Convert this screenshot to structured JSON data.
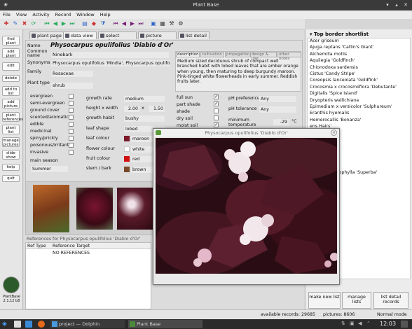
{
  "window": {
    "title": "Plant Base",
    "logo_label": "PlantBase 2.1.12 b8"
  },
  "menu": [
    "File",
    "View",
    "Activity",
    "Record",
    "Window",
    "Help"
  ],
  "tabs": [
    "plant page",
    "data view",
    "select plants",
    "picture maint",
    "list detail"
  ],
  "left_buttons": [
    "find plant",
    "add plant",
    "edit",
    "delete",
    "add to list",
    "add picture",
    "plant references",
    "plant list",
    "manage pictures",
    "slide show",
    "help",
    "quit"
  ],
  "record": {
    "name_label": "Name",
    "name": "Physocarpus opulifolius 'Diablo d'Or'",
    "common_label": "Common name",
    "common": "Ninebark",
    "syn_label": "Synonyms",
    "synonyms": "Physocarpus opulifolius 'Mindia', Physocarpus opulifolius 'Copp",
    "family_label": "Family",
    "family": "Rosaceae",
    "type_label": "Plant type",
    "type": "shrub",
    "desc_tabs": [
      "description",
      "cultivation",
      "propagation",
      "design & use",
      "other notes"
    ],
    "description": "Medium sized deciduous shrub of compact well branched habit with lobed leaves that are amber orange when young, then maturing to deep burgundy maroon. Pink-tinged white flowerheads in early summer. Reddish fruits later.",
    "flags": [
      "evergreen",
      "semi-evergreen",
      "ground cover",
      "scented/aromatic",
      "edible",
      "medicinal",
      "spiny/prickly",
      "poisonous/irritant",
      "invasive"
    ],
    "main_season_label": "main season",
    "main_season": "Summer",
    "growth_rate_label": "growth rate",
    "growth_rate": "medium",
    "hxw_label": "height x width",
    "height": "2.00",
    "x": "x",
    "width": "1.50",
    "habit_label": "growth habit",
    "habit": "bushy",
    "leaf_shape_label": "leaf shape",
    "leaf_shape": "lobed",
    "leaf_colour_label": "leaf colour",
    "leaf_colour": "maroon",
    "flower_colour_label": "flower colour",
    "flower_colour": "white",
    "fruit_colour_label": "fruit colour",
    "fruit_colour": "red",
    "stem_label": "stem / bark",
    "stem": "brown",
    "sun": [
      "full sun",
      "part shade",
      "shade",
      "dry soil",
      "moist soil"
    ],
    "ph_pref_label": "pH preference",
    "ph_pref": "Any",
    "ph_tol_label": "pH tolerance",
    "ph_tol": "Any",
    "min_temp_label": "minimum temperature",
    "min_temp": "-29",
    "temp_unit": "°C"
  },
  "references": {
    "header": "References for Physocarpus opulifolius 'Diablo d'Or'",
    "col1": "Ref Type",
    "col2": "Reference Target",
    "row": "NO REFERENCES"
  },
  "shortlist": {
    "title": "Top border shortlist",
    "items": [
      "Acer griseum",
      "Ajuga reptans 'Catlin's Giant'",
      "Alchemilla mollis",
      "Aquilegia 'Goldfinch'",
      "Chionodoxa sardensis",
      "Cistus 'Candy Stripe'",
      "Coreopsis lanceolata 'Goldfink'",
      "Crocosmia x crocosmiiflora 'Debutante'",
      "Digitalis 'Spice Island'",
      "Dryopteris wallichiana",
      "Epimedium x versicolor 'Sulphureum'",
      "Eranthis hyemalis",
      "Hemerocallis 'Bonanza'",
      "ens Hairs'",
      "den Chimes'",
      "",
      "Nosed'",
      "",
      "",
      "",
      "ens ssp. microphylla 'Superba'",
      "is 'Smaragd'",
      "",
      "",
      "",
      "Seven Cities'",
      "",
      "",
      "",
      "",
      "",
      "",
      "",
      "",
      ""
    ]
  },
  "right_buttons": [
    "make new list",
    "manage lists",
    "list detail records"
  ],
  "popup": {
    "title": "Physocarpus opulifolius 'Diablo d'Or'"
  },
  "status": {
    "records": "available records: 29685",
    "pictures": "pictures: 8606",
    "mode": "Normal mode"
  },
  "taskbar": {
    "task1": "project — Dolphin",
    "task2": "Plant Base",
    "time": "12:03"
  }
}
